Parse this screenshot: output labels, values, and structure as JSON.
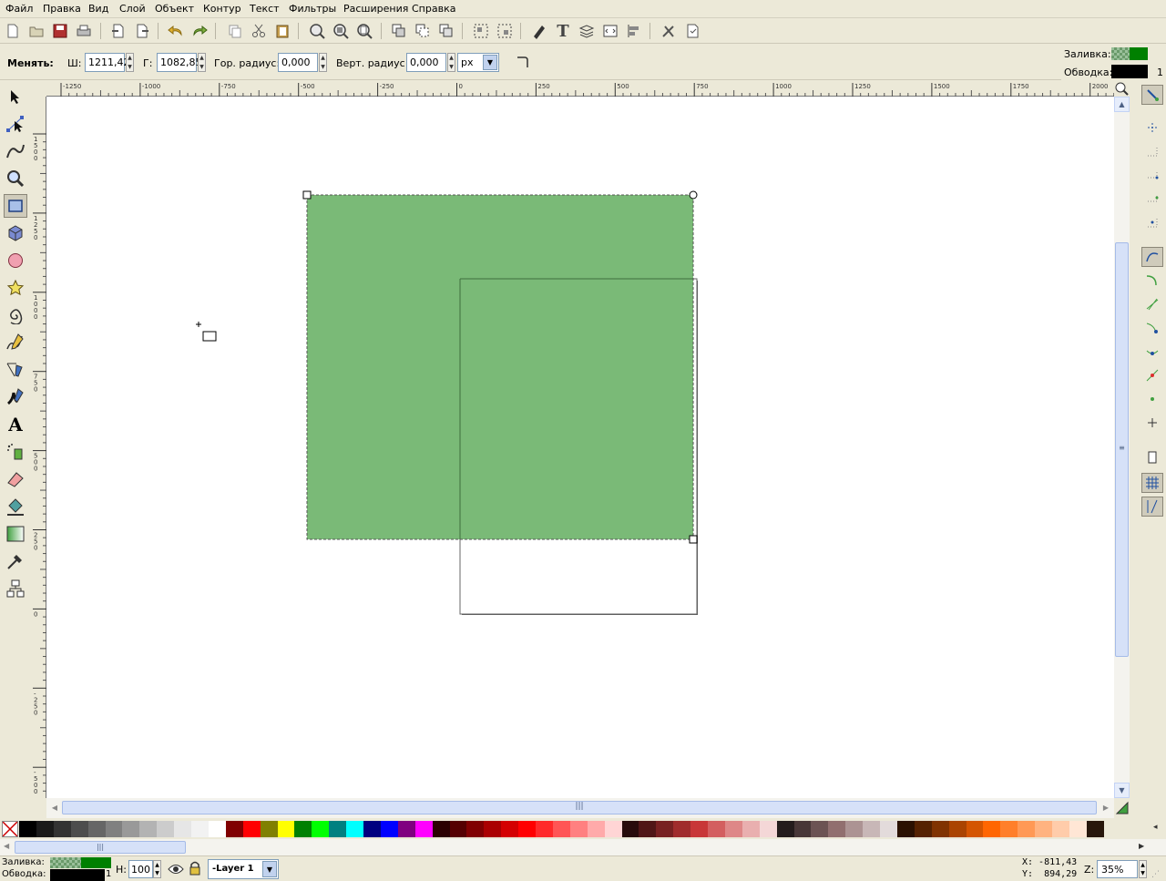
{
  "menu": [
    "Файл",
    "Правка",
    "Вид",
    "Слой",
    "Объект",
    "Контур",
    "Текст",
    "Фильтры",
    "Расширения",
    "Справка"
  ],
  "toolbar_icons": [
    "new-icon",
    "open-icon",
    "save-icon",
    "print-icon",
    "import-icon",
    "export-icon",
    "undo-icon",
    "redo-icon",
    "copy-icon",
    "cut-icon",
    "paste-icon",
    "zoom-selection-icon",
    "zoom-drawing-icon",
    "zoom-page-icon",
    "duplicate-icon",
    "clone-icon",
    "unlink-clone-icon",
    "group-icon",
    "ungroup-icon",
    "fill-stroke-icon",
    "text-font-icon",
    "layers-icon",
    "xml-editor-icon",
    "align-icon",
    "preferences-icon",
    "document-properties-icon"
  ],
  "controls": {
    "change_label": "Менять:",
    "w_label": "Ш:",
    "w_value": "1211,42",
    "h_label": "Г:",
    "h_value": "1082,85",
    "rx_label": "Гор. радиус:",
    "rx_value": "0,000",
    "ry_label": "Верт. радиус:",
    "ry_value": "0,000",
    "unit": "px"
  },
  "style_indicator": {
    "fill_label": "Заливка:",
    "stroke_label": "Обводка:",
    "stroke_width": "1",
    "fill_color": "#008000",
    "stroke_color": "#000000"
  },
  "ruler": {
    "top_ticks": [
      "-1250",
      "-1000",
      "-750",
      "-500",
      "-250",
      "0",
      "250",
      "500",
      "750",
      "1000",
      "1250",
      "1500",
      "1750",
      "2000"
    ],
    "left_ticks": [
      "1500",
      "1250",
      "1000",
      "750",
      "500",
      "250",
      "0",
      "-250",
      "-500"
    ]
  },
  "canvas": {
    "rect_fill": "#7aba77",
    "page_border": "#666666"
  },
  "palette": [
    "#000000",
    "#1a1a1a",
    "#333333",
    "#4d4d4d",
    "#666666",
    "#808080",
    "#999999",
    "#b3b3b3",
    "#cccccc",
    "#e6e6e6",
    "#f2f2f2",
    "#ffffff",
    "#800000",
    "#ff0000",
    "#808000",
    "#ffff00",
    "#008000",
    "#00ff00",
    "#008080",
    "#00ffff",
    "#000080",
    "#0000ff",
    "#800080",
    "#ff00ff",
    "#2b0000",
    "#550000",
    "#800000",
    "#aa0000",
    "#d40000",
    "#ff0000",
    "#ff2a2a",
    "#ff5555",
    "#ff8080",
    "#ffaaaa",
    "#ffd5d5",
    "#280b0b",
    "#501616",
    "#782121",
    "#a02c2c",
    "#c83737",
    "#d35f5f",
    "#de8787",
    "#e9afaf",
    "#f4d7d7",
    "#241c1c",
    "#483737",
    "#6c5353",
    "#916f6f",
    "#ac9393",
    "#c8b7b7",
    "#e3dbdb",
    "#2b1100",
    "#552200",
    "#803300",
    "#aa4400",
    "#d45500",
    "#ff6600",
    "#ff7f2a",
    "#ff9955",
    "#ffb380",
    "#ffccaa",
    "#ffe6d5",
    "#28170b"
  ],
  "status": {
    "fill_label": "Заливка:",
    "stroke_label": "Обводка:",
    "stroke_width": "1",
    "h_label": "Н:",
    "h_value": "100",
    "layer": "-Layer 1",
    "x_coord": "X: -811,43",
    "y_coord": "Y:  894,29",
    "zoom_label": "Z:",
    "zoom_value": "35%"
  }
}
